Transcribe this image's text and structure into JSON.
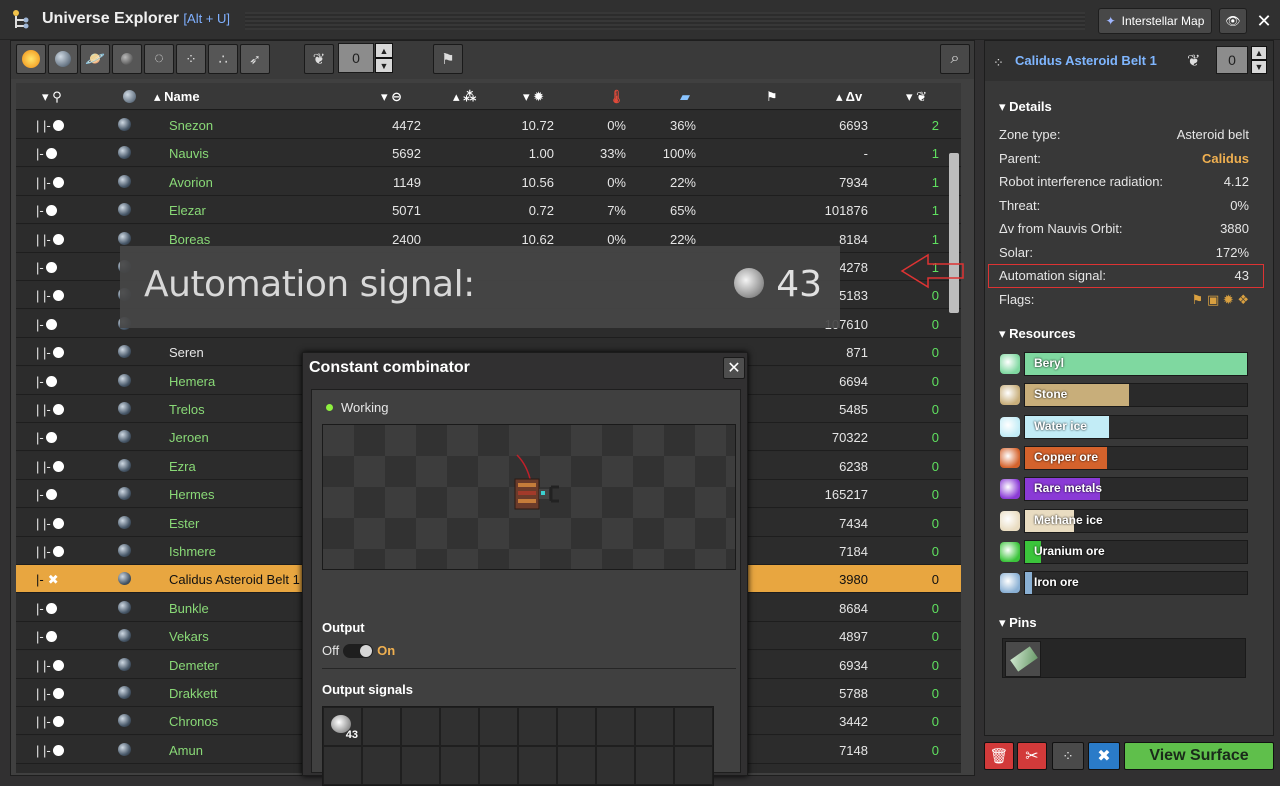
{
  "title": "Universe Explorer",
  "hotkey": "[Alt + U]",
  "header": {
    "map_button": "Interstellar Map"
  },
  "toolbar": {
    "count": "0"
  },
  "table": {
    "columns": [
      "Name",
      "Δv"
    ],
    "rows": [
      {
        "tree": "|   |-",
        "dot": "white",
        "name": "Snezon",
        "c1": "4472",
        "c3": "10.72",
        "c4": "0%",
        "c5": "36%",
        "dv": "6693",
        "pri": "2",
        "color": "green"
      },
      {
        "tree": "|-",
        "dot": "white",
        "name": "Nauvis",
        "c1": "5692",
        "c3": "1.00",
        "c4": "33%",
        "c5": "100%",
        "dv": "-",
        "pri": "1",
        "color": "green"
      },
      {
        "tree": "|   |-",
        "dot": "white",
        "name": "Avorion",
        "c1": "1149",
        "c3": "10.56",
        "c4": "0%",
        "c5": "22%",
        "dv": "7934",
        "pri": "1",
        "color": "green"
      },
      {
        "tree": "|-",
        "dot": "white",
        "name": "Elezar",
        "c1": "5071",
        "c3": "0.72",
        "c4": "7%",
        "c5": "65%",
        "dv": "101876",
        "pri": "1",
        "color": "green"
      },
      {
        "tree": "|   |-",
        "dot": "white",
        "name": "Boreas",
        "c1": "2400",
        "c3": "10.62",
        "c4": "0%",
        "c5": "22%",
        "dv": "8184",
        "pri": "1",
        "color": "green"
      },
      {
        "tree": "|-",
        "dot": "white",
        "name": "",
        "c1": "",
        "c3": "",
        "c4": "",
        "c5": "",
        "dv": "4278",
        "pri": "1",
        "color": "green"
      },
      {
        "tree": "|   |-",
        "dot": "white",
        "name": "",
        "c1": "",
        "c3": "",
        "c4": "",
        "c5": "",
        "dv": "5183",
        "pri": "0",
        "color": "green"
      },
      {
        "tree": "|-",
        "dot": "white",
        "name": "",
        "c1": "",
        "c3": "",
        "c4": "",
        "c5": "",
        "dv": "107610",
        "pri": "0",
        "color": "green"
      },
      {
        "tree": "|   |-",
        "dot": "white",
        "name": "Seren",
        "c1": "",
        "c3": "",
        "c4": "",
        "c5": "",
        "dv": "871",
        "pri": "0",
        "color": "white"
      },
      {
        "tree": "|-",
        "dot": "white",
        "name": "Hemera",
        "c1": "",
        "c3": "",
        "c4": "",
        "c5": "",
        "dv": "6694",
        "pri": "0",
        "color": "green"
      },
      {
        "tree": "|   |-",
        "dot": "white",
        "name": "Trelos",
        "c1": "",
        "c3": "",
        "c4": "",
        "c5": "",
        "dv": "5485",
        "pri": "0",
        "color": "green"
      },
      {
        "tree": "|-",
        "dot": "white",
        "name": "Jeroen",
        "c1": "",
        "c3": "",
        "c4": "",
        "c5": "",
        "dv": "70322",
        "pri": "0",
        "color": "green"
      },
      {
        "tree": "|   |-",
        "dot": "white",
        "name": "Ezra",
        "c1": "",
        "c3": "",
        "c4": "",
        "c5": "",
        "dv": "6238",
        "pri": "0",
        "color": "green"
      },
      {
        "tree": "|-",
        "dot": "white",
        "name": "Hermes",
        "c1": "",
        "c3": "",
        "c4": "",
        "c5": "",
        "dv": "165217",
        "pri": "0",
        "color": "green"
      },
      {
        "tree": "|   |-",
        "dot": "white",
        "name": "Ester",
        "c1": "",
        "c3": "",
        "c4": "",
        "c5": "",
        "dv": "7434",
        "pri": "0",
        "color": "green"
      },
      {
        "tree": "|   |-",
        "dot": "white",
        "name": "Ishmere",
        "c1": "",
        "c3": "",
        "c4": "",
        "c5": "",
        "dv": "7184",
        "pri": "0",
        "color": "green"
      },
      {
        "tree": "|-",
        "dot": "x",
        "name": "Calidus Asteroid Belt 1",
        "c1": "",
        "c3": "",
        "c4": "",
        "c5": "",
        "dv": "3980",
        "pri": "0",
        "color": "selected"
      },
      {
        "tree": "|-",
        "dot": "white",
        "name": "Bunkle",
        "c1": "",
        "c3": "",
        "c4": "",
        "c5": "",
        "dv": "8684",
        "pri": "0",
        "color": "green"
      },
      {
        "tree": "|-",
        "dot": "white",
        "name": "Vekars",
        "c1": "",
        "c3": "",
        "c4": "",
        "c5": "",
        "dv": "4897",
        "pri": "0",
        "color": "green"
      },
      {
        "tree": "|   |-",
        "dot": "white",
        "name": "Demeter",
        "c1": "",
        "c3": "",
        "c4": "",
        "c5": "",
        "dv": "6934",
        "pri": "0",
        "color": "green"
      },
      {
        "tree": "|   |-",
        "dot": "white",
        "name": "Drakkett",
        "c1": "",
        "c3": "",
        "c4": "",
        "c5": "",
        "dv": "5788",
        "pri": "0",
        "color": "green"
      },
      {
        "tree": "|   |-",
        "dot": "white",
        "name": "Chronos",
        "c1": "",
        "c3": "",
        "c4": "",
        "c5": "",
        "dv": "3442",
        "pri": "0",
        "color": "green"
      },
      {
        "tree": "|   |-",
        "dot": "white",
        "name": "Amun",
        "c1": "",
        "c3": "",
        "c4": "",
        "c5": "",
        "dv": "7148",
        "pri": "0",
        "color": "green"
      }
    ]
  },
  "overlay": {
    "label": "Automation signal:",
    "value": "43"
  },
  "combinator": {
    "title": "Constant combinator",
    "status": "Working",
    "output_label": "Output",
    "off": "Off",
    "on": "On",
    "signals_label": "Output signals",
    "signal_count": "43"
  },
  "details": {
    "zone_title": "Calidus Asteroid Belt 1",
    "zone_count": "0",
    "section": "Details",
    "items": [
      {
        "k": "Zone type:",
        "v": "Asteroid belt"
      },
      {
        "k": "Parent:",
        "v": "Calidus"
      },
      {
        "k": "Robot interference radiation:",
        "v": "4.12"
      },
      {
        "k": "Threat:",
        "v": "0%"
      },
      {
        "k": "Δv from Nauvis Orbit:",
        "v": "3880"
      },
      {
        "k": "Solar:",
        "v": "172%"
      },
      {
        "k": "Automation signal:",
        "v": "43"
      },
      {
        "k": "Flags:",
        "v": ""
      }
    ]
  },
  "resources": {
    "section": "Resources",
    "items": [
      {
        "name": "Beryl",
        "fill": 1.0,
        "color": "#7fd8a0"
      },
      {
        "name": "Stone",
        "fill": 0.47,
        "color": "#c8ae7a"
      },
      {
        "name": "Water ice",
        "fill": 0.38,
        "color": "#c2ecf6"
      },
      {
        "name": "Copper ore",
        "fill": 0.37,
        "color": "#d4622c"
      },
      {
        "name": "Rare metals",
        "fill": 0.34,
        "color": "#8a3ad6"
      },
      {
        "name": "Methane ice",
        "fill": 0.22,
        "color": "#e9dcc1"
      },
      {
        "name": "Uranium ore",
        "fill": 0.07,
        "color": "#3bc43b"
      },
      {
        "name": "Iron ore",
        "fill": 0.03,
        "color": "#8ab0d4"
      }
    ]
  },
  "pins": {
    "section": "Pins"
  },
  "footer": {
    "view_surface": "View Surface"
  }
}
